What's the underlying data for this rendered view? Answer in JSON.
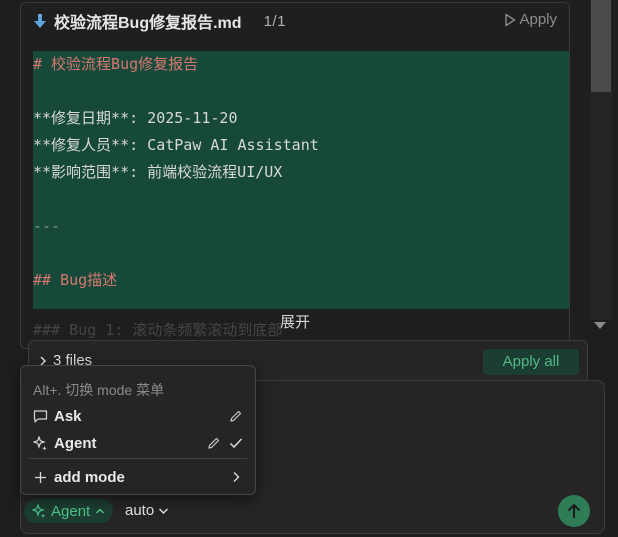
{
  "editor": {
    "filename": "校验流程Bug修复报告.md",
    "page_count": "1/1",
    "apply_label": "Apply",
    "code_lines": [
      {
        "text": "# 校验流程Bug修复报告",
        "style": "head"
      },
      {
        "text": "",
        "style": "plain"
      },
      {
        "text": "**修复日期**: 2025-11-20",
        "style": "plain"
      },
      {
        "text": "**修复人员**: CatPaw AI Assistant",
        "style": "plain"
      },
      {
        "text": "**影响范围**: 前端校验流程UI/UX",
        "style": "plain"
      },
      {
        "text": "",
        "style": "plain"
      },
      {
        "text": "---",
        "style": "dim"
      },
      {
        "text": "",
        "style": "plain"
      },
      {
        "text": "## Bug描述",
        "style": "head"
      }
    ],
    "faded_line": "### Bug 1: 滚动条频繁滚动到底部",
    "expand_label": "展开"
  },
  "files_bar": {
    "label": "3 files",
    "apply_all_label": "Apply all"
  },
  "mode_menu": {
    "hint": "Alt+. 切换 mode 菜单",
    "items": [
      {
        "label": "Ask",
        "icon": "chat-bubble-icon",
        "selected": false
      },
      {
        "label": "Agent",
        "icon": "sparkle-icon",
        "selected": true
      }
    ],
    "add_label": "add mode"
  },
  "composer": {
    "mode_chip": "Agent",
    "model_select": "auto"
  },
  "colors": {
    "accent_green": "#4fc28a",
    "code_bg": "#17493b",
    "heading_red": "#d6776d"
  }
}
